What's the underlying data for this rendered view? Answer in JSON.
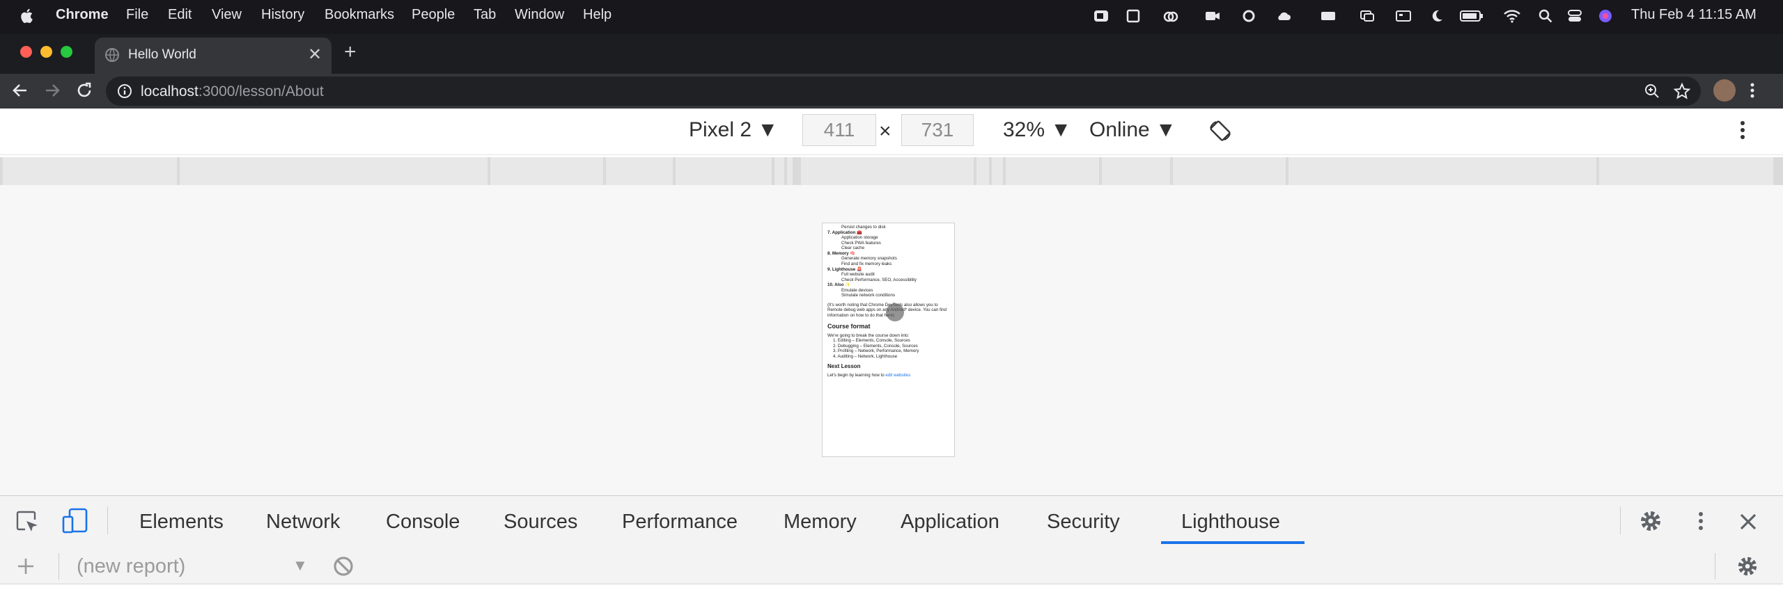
{
  "menubar": {
    "app_name": "Chrome",
    "items": [
      "File",
      "Edit",
      "View",
      "History",
      "Bookmarks",
      "People",
      "Tab",
      "Window",
      "Help"
    ],
    "clock": "Thu Feb 4  11:15 AM"
  },
  "browser": {
    "tab_title": "Hello World",
    "new_tab": "+",
    "url_host": "localhost",
    "url_rest": ":3000/lesson/About"
  },
  "device_toolbar": {
    "device": "Pixel 2",
    "width": "411",
    "height": "731",
    "times": "×",
    "zoom": "32%",
    "network": "Online"
  },
  "page": {
    "lines": [
      {
        "t": "Persist changes to disk",
        "c": "ind"
      },
      {
        "t": "7. Application 🧰",
        "c": "b"
      },
      {
        "t": "Application storage",
        "c": "ind"
      },
      {
        "t": "Check PWA features",
        "c": "ind"
      },
      {
        "t": "Clear cache",
        "c": "ind"
      },
      {
        "t": "8. Memory 🧠",
        "c": "b"
      },
      {
        "t": "Generate memory snapshots",
        "c": "ind"
      },
      {
        "t": "Find and fix memory leaks",
        "c": "ind"
      },
      {
        "t": "9. Lighthouse 🚨",
        "c": "b"
      },
      {
        "t": "Full website audit",
        "c": "ind"
      },
      {
        "t": "Check Performance, SEO, Accessibility",
        "c": "ind"
      },
      {
        "t": "10. Also ✨",
        "c": "b"
      },
      {
        "t": "Emulate devices",
        "c": "ind"
      },
      {
        "t": "Simulate network conditions",
        "c": "ind"
      }
    ],
    "note": "(It's worth noting that Chrome DevTools also allows you to Remote debug web apps on any Android* device. You can find information on how to do that here)",
    "course_heading": "Course format",
    "course_intro": "We're going to break the course down into:",
    "course_items": [
      "1. Editing – Elements, Console, Sources",
      "2. Debugging – Elements, Console, Sources",
      "3. Profiling – Network, Performance, Memory",
      "4. Auditing – Network, Lighthouse"
    ],
    "next_heading": "Next Lesson",
    "next_text": "Let's begin by learning how to ",
    "next_link": "edit websites"
  },
  "devtools": {
    "tabs": [
      "Elements",
      "Network",
      "Console",
      "Sources",
      "Performance",
      "Memory",
      "Application",
      "Security",
      "Lighthouse"
    ],
    "active_tab": "Lighthouse",
    "report_select": "(new report)",
    "accent": "#1a73e8"
  }
}
